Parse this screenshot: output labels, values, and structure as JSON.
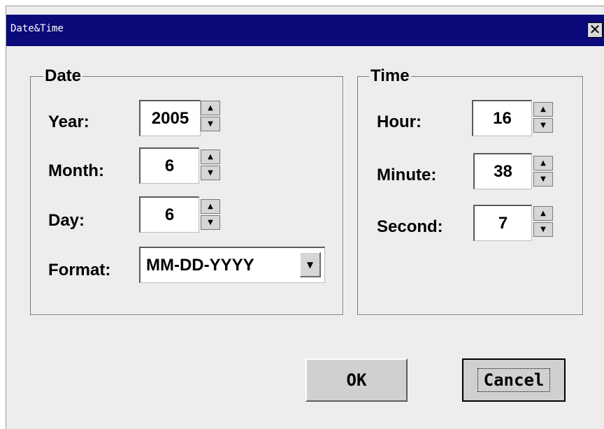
{
  "window": {
    "title": "Date&Time",
    "close_glyph": "✕"
  },
  "date_group": {
    "label": "Date",
    "year": {
      "label": "Year:",
      "value": "2005"
    },
    "month": {
      "label": "Month:",
      "value": "6"
    },
    "day": {
      "label": "Day:",
      "value": "6"
    },
    "format": {
      "label": "Format:",
      "value": "MM-DD-YYYY"
    }
  },
  "time_group": {
    "label": "Time",
    "hour": {
      "label": "Hour:",
      "value": "16"
    },
    "minute": {
      "label": "Minute:",
      "value": "38"
    },
    "second": {
      "label": "Second:",
      "value": "7"
    }
  },
  "buttons": {
    "ok": "OK",
    "cancel": "Cancel"
  },
  "glyphs": {
    "up": "▲",
    "down": "▼"
  },
  "colors": {
    "titlebar": "#0a0a7a",
    "face": "#ededed"
  }
}
